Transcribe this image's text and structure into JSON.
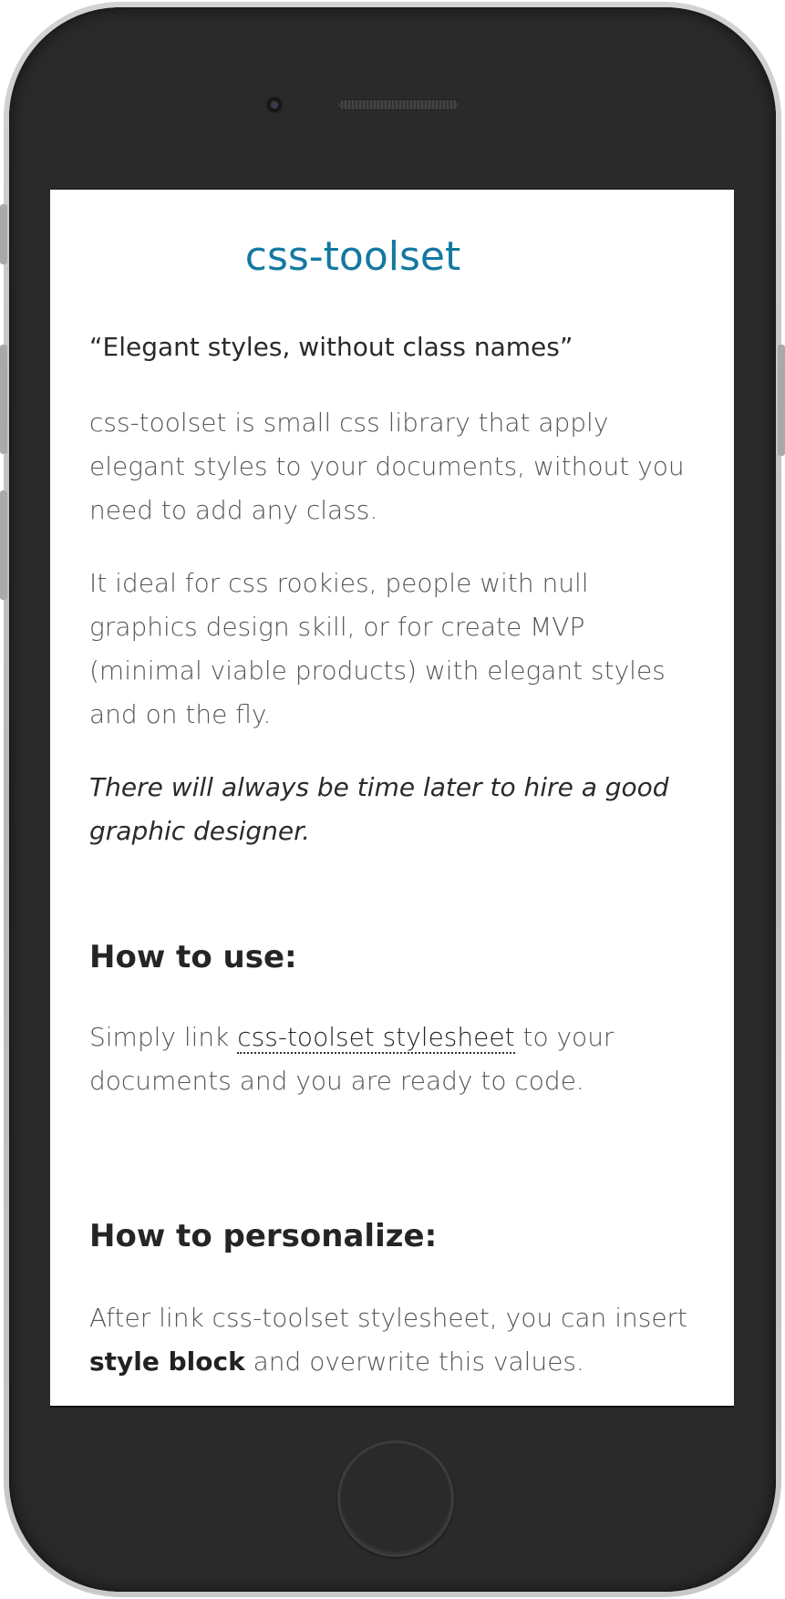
{
  "site": {
    "title": "css-toolset",
    "tagline": "“Elegant styles, without class names”"
  },
  "intro": {
    "p1": "css-toolset is small css library that apply elegant styles to your documents, without you need to add any class.",
    "p2": "It ideal for css rookies, people with null graphics design skill, or for create MVP (minimal viable products) with elegant styles and on the fly.",
    "p3": "There will always be time later to hire a good graphic designer."
  },
  "how_to_use": {
    "heading": "How to use:",
    "text_before": "Simply link ",
    "link_text": "css-toolset stylesheet",
    "text_after": " to your documents and you are ready to code."
  },
  "how_to_personalize": {
    "heading": "How to personalize:",
    "text_before": "After link css-toolset stylesheet, you can insert ",
    "bold_text": "style block",
    "text_after": " and overwrite this values."
  },
  "device": {
    "frame_color": "#2a2a2a",
    "accent_color": "#1478a0"
  }
}
